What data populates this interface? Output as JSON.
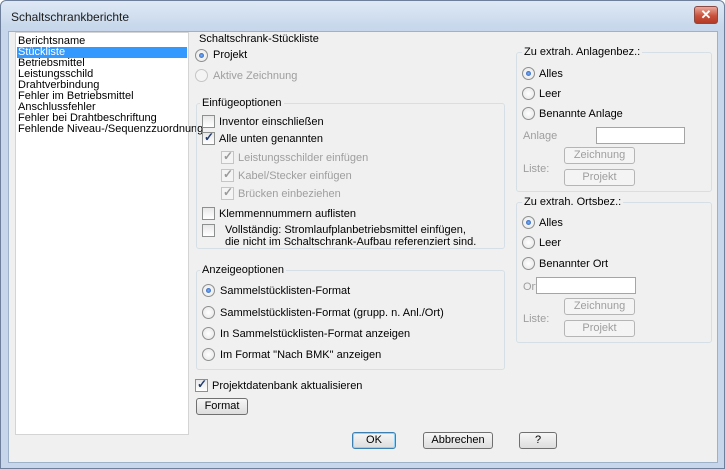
{
  "window": {
    "title": "Schaltschrankberichte",
    "close_glyph": "✕"
  },
  "report_list": {
    "header": "Berichtsname",
    "items": [
      "Stückliste",
      "Betriebsmittel",
      "Leistungsschild",
      "Drahtverbindung",
      "Fehler im Betriebsmittel",
      "Anschlussfehler",
      "Fehler bei Drahtbeschriftung",
      "Fehlende Niveau-/Sequenzzuordnung"
    ],
    "selected_index": 0
  },
  "main_group": {
    "title": "Schaltschrank-Stückliste",
    "scope": [
      {
        "label": "Projekt",
        "checked": true,
        "enabled": true
      },
      {
        "label": "Aktive Zeichnung",
        "checked": false,
        "enabled": false
      }
    ]
  },
  "insert_options": {
    "title": "Einfügeoptionen",
    "include_inventor": {
      "label": "Inventor einschließen",
      "checked": false
    },
    "all_below": {
      "label": "Alle unten genannten",
      "checked": true
    },
    "sub_options": [
      {
        "label": "Leistungsschilder einfügen",
        "checked": true
      },
      {
        "label": "Kabel/Stecker einfügen",
        "checked": true
      },
      {
        "label": "Brücken einbeziehen",
        "checked": true
      }
    ],
    "terminal_numbers": {
      "label": "Klemmennummern auflisten",
      "checked": false
    },
    "complete": {
      "label_line1": "Vollständig: Stromlaufplanbetriebsmittel einfügen,",
      "label_line2": "die nicht im Schaltschrank-Aufbau referenziert sind.",
      "checked": false
    }
  },
  "display_options": {
    "title": "Anzeigeoptionen",
    "options": [
      {
        "label": "Sammelstücklisten-Format",
        "checked": true
      },
      {
        "label": "Sammelstücklisten-Format (grupp. n. Anl./Ort)",
        "checked": false
      },
      {
        "label": "In Sammelstücklisten-Format anzeigen",
        "checked": false
      },
      {
        "label": "Im Format \"Nach BMK\" anzeigen",
        "checked": false
      }
    ]
  },
  "update_db": {
    "label": "Projektdatenbank aktualisieren",
    "checked": true
  },
  "format_button": "Format",
  "installation_group": {
    "title": "Zu extrah. Anlagenbez.:",
    "options": [
      {
        "label": "Alles",
        "checked": true
      },
      {
        "label": "Leer",
        "checked": false
      },
      {
        "label": "Benannte Anlage",
        "checked": false
      }
    ],
    "field_label": "Anlage",
    "field_value": "",
    "list_label": "Liste:",
    "drawing_button": "Zeichnung",
    "project_button": "Projekt"
  },
  "location_group": {
    "title": "Zu extrah. Ortsbez.:",
    "options": [
      {
        "label": "Alles",
        "checked": true
      },
      {
        "label": "Leer",
        "checked": false
      },
      {
        "label": "Benannter Ort",
        "checked": false
      }
    ],
    "field_label": "Ort",
    "field_value": "",
    "list_label": "Liste:",
    "drawing_button": "Zeichnung",
    "project_button": "Projekt"
  },
  "footer": {
    "ok": "OK",
    "cancel": "Abbrechen",
    "help": "?"
  }
}
